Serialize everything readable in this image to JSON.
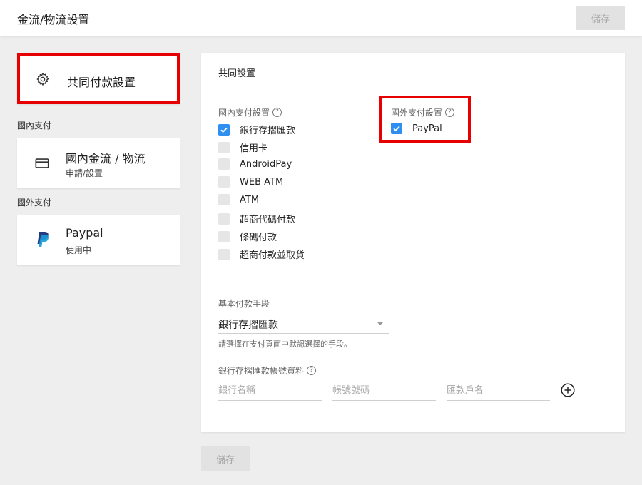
{
  "header": {
    "title": "金流/物流設置",
    "save_label": "儲存"
  },
  "sidebar": {
    "common": {
      "label": "共同付款設置",
      "icon": "gear-icon"
    },
    "domain_section": "國內支付",
    "domestic": {
      "name": "國內金流 / 物流",
      "sub": "申請/設置",
      "icon": "credit-card-icon"
    },
    "foreign_section": "國外支付",
    "paypal": {
      "name": "Paypal",
      "sub": "使用中",
      "icon": "paypal-logo-icon"
    }
  },
  "panel": {
    "title": "共同設置",
    "domestic_group": {
      "title": "國內支付設置",
      "options": [
        {
          "label": "銀行存摺匯款",
          "checked": true
        },
        {
          "label": "信用卡",
          "checked": false
        },
        {
          "label": "AndroidPay",
          "checked": false
        },
        {
          "label": "WEB ATM",
          "checked": false
        },
        {
          "label": "ATM",
          "checked": false
        },
        {
          "label": "超商代碼付款",
          "checked": false
        },
        {
          "label": "條碼付款",
          "checked": false
        },
        {
          "label": "超商付款並取貨",
          "checked": false
        }
      ]
    },
    "foreign_group": {
      "title": "國外支付設置",
      "options": [
        {
          "label": "PayPal",
          "checked": true
        }
      ]
    },
    "default_method": {
      "label": "基本付款手段",
      "value": "銀行存摺匯款",
      "hint": "請選擇在支付頁面中默認選擇的手段。"
    },
    "bank_account": {
      "label": "銀行存摺匯款帳號資料",
      "bank_name_placeholder": "銀行名稱",
      "account_number_placeholder": "帳號號碼",
      "account_holder_placeholder": "匯款戶名"
    },
    "save_label": "儲存"
  },
  "colors": {
    "accent": "#2f8ff0",
    "highlight_border": "#e60000",
    "paypal_dark": "#253b80",
    "paypal_light": "#179bd7"
  }
}
